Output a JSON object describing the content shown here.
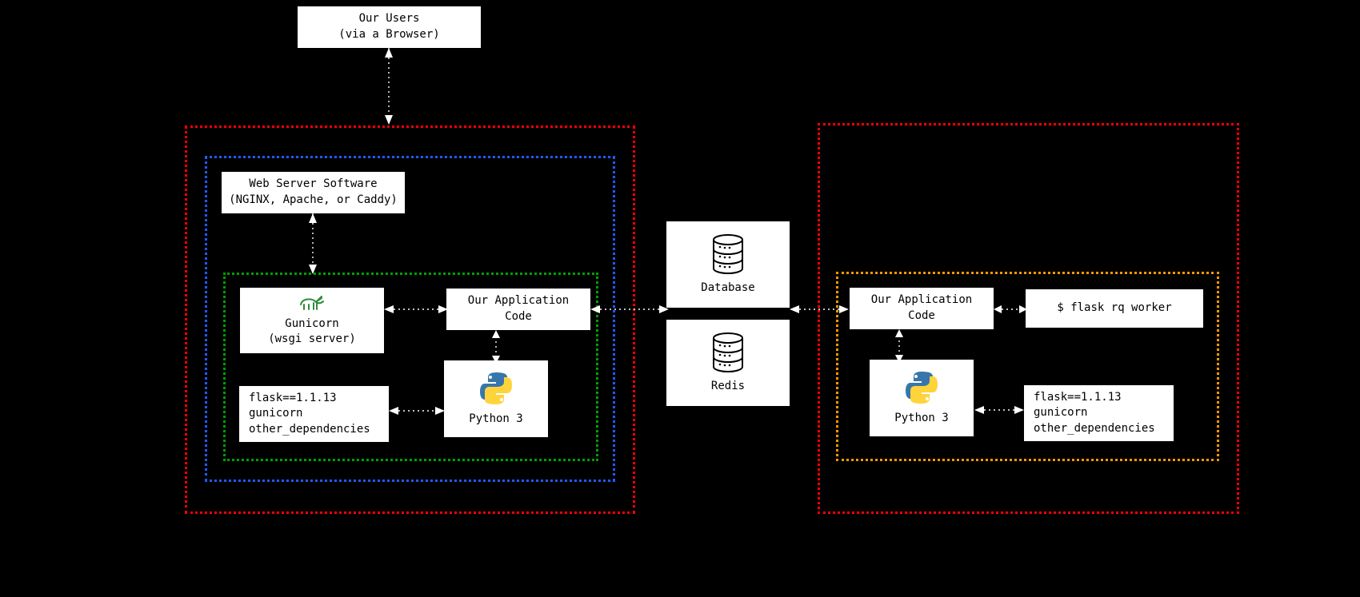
{
  "users": {
    "line1": "Our Users",
    "line2": "(via a Browser)"
  },
  "webserver": {
    "line1": "Web Server Software",
    "line2": "(NGINX, Apache, or Caddy)"
  },
  "gunicorn": {
    "line1": "Gunicorn",
    "line2": "(wsgi server)"
  },
  "appcode": "Our Application\nCode",
  "python": "Python 3",
  "deps": {
    "l1": "flask==1.1.13",
    "l2": "gunicorn",
    "l3": "other_dependencies"
  },
  "database": "Database",
  "redis": "Redis",
  "worker_cmd": "$ flask rq worker"
}
